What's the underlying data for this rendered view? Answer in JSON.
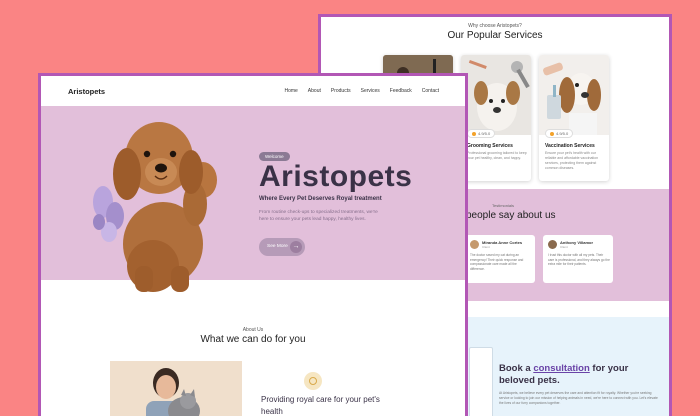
{
  "back": {
    "services": {
      "eyebrow": "Why choose Aristopets?",
      "title": "Our Popular Services",
      "cards": [
        {
          "badge": "",
          "name": "",
          "desc": ""
        },
        {
          "badge": "4.9/5.0",
          "name": "Grooming Services",
          "desc": "Professional grooming tailored to keep your pet healthy, clean, and happy."
        },
        {
          "badge": "4.9/5.0",
          "name": "Vaccination Services",
          "desc": "Ensure your pet's health with our reliable and affordable vaccination services, protecting them against common diseases."
        }
      ]
    },
    "testimonials": {
      "eyebrow": "Testimonials",
      "title": "people say about us",
      "cards": [
        {
          "name": "Miranda Anne Cortes",
          "role": "Client",
          "text": "The doctor saved my cat during an emergency! Their quick response and compassionate care made all the difference."
        },
        {
          "name": "Anthony Villamor",
          "role": "Client",
          "text": "I trust this doctor with all my pets. Their care is professional, and they always go the extra mile for their patients."
        }
      ]
    },
    "consult": {
      "title_pre": "Book a ",
      "title_highlight": "consultation",
      "title_post": " for your beloved pets.",
      "desc": "At Aristopets, we believe every pet deserves the care and attention fit for royalty. Whether you're seeking service or looking to join our mission of helping animals in need, we're here to connect with you. Let's elevate the lives of our furry companions together."
    }
  },
  "front": {
    "brand": "Aristopets",
    "nav": [
      "Home",
      "About",
      "Products",
      "Services",
      "Feedback",
      "Contact"
    ],
    "hero": {
      "welcome": "Welcome",
      "title": "Aristopets",
      "subtitle": "Where Every Pet Deserves Royal treatment",
      "desc": "From routine check-ups to specialized treatments, we're here to ensure your pets lead happy, healthy lives.",
      "cta": "See More",
      "cta_arrow": "→"
    },
    "about": {
      "eyebrow": "About Us",
      "title": "What we can do for you",
      "text": "Providing royal care for your pet's health"
    }
  },
  "colors": {
    "background": "#fa8484",
    "frame": "#b257b5",
    "hero_bg": "#e2bfda",
    "heading": "#3a3247"
  }
}
